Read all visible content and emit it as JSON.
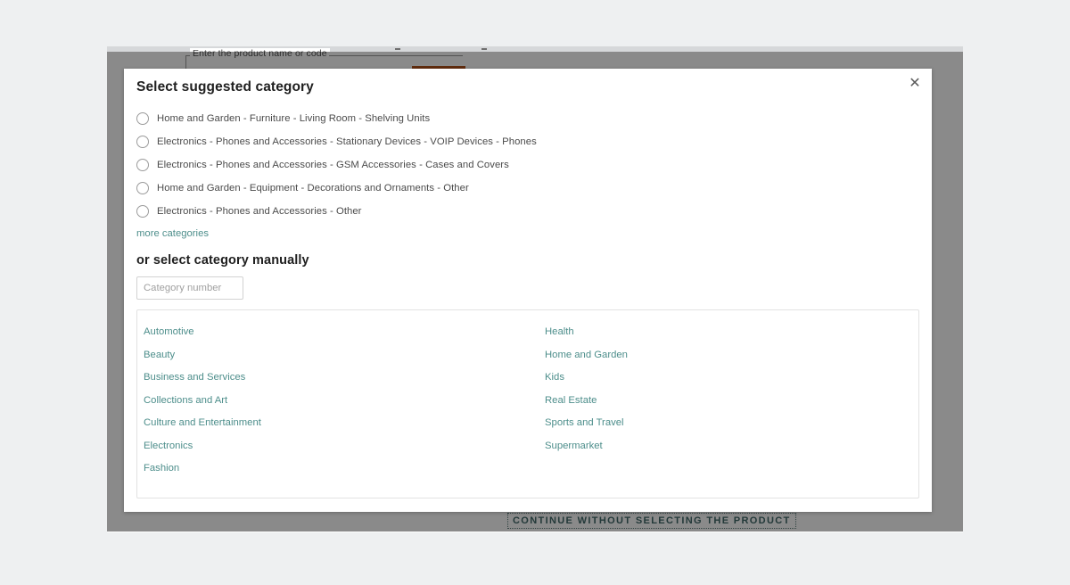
{
  "background_page": {
    "product_field_label": "Enter the product name or code",
    "continue_button_label": "CONTINUE WITHOUT SELECTING THE PRODUCT",
    "accent_orange": "#b1521b"
  },
  "modal": {
    "close_icon": "close-icon",
    "close_glyph": "✕",
    "suggested_title": "Select suggested category",
    "suggested_categories": [
      {
        "label": "Home and Garden - Furniture - Living Room - Shelving Units",
        "selected": false
      },
      {
        "label": "Electronics - Phones and Accessories - Stationary Devices - VOIP Devices - Phones",
        "selected": false
      },
      {
        "label": "Electronics - Phones and Accessories - GSM Accessories - Cases and Covers",
        "selected": false
      },
      {
        "label": "Home and Garden - Equipment - Decorations and Ornaments - Other",
        "selected": false
      },
      {
        "label": "Electronics - Phones and Accessories - Other",
        "selected": false
      }
    ],
    "more_categories_label": "more categories",
    "manual_title": "or select category manually",
    "category_number_input": {
      "value": "",
      "placeholder": "Category number"
    },
    "category_columns": {
      "left": [
        "Automotive",
        "Beauty",
        "Business and Services",
        "Collections and Art",
        "Culture and Entertainment",
        "Electronics",
        "Fashion"
      ],
      "right": [
        "Health",
        "Home and Garden",
        "Kids",
        "Real Estate",
        "Sports and Travel",
        "Supermarket"
      ]
    },
    "link_color": "#4d8e8b"
  }
}
